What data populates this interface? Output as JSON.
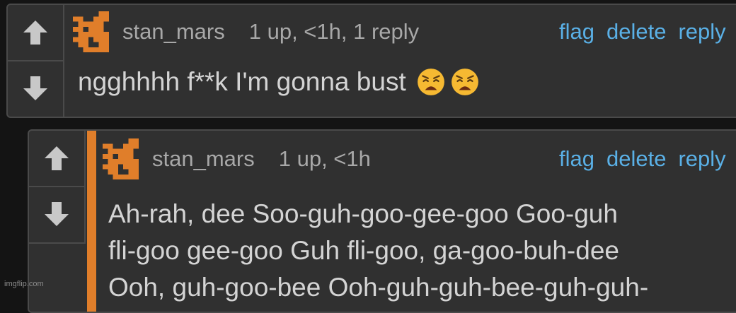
{
  "comments": [
    {
      "username": "stan_mars",
      "meta": "1 up, <1h, 1 reply",
      "actions": {
        "flag": "flag",
        "delete": "delete",
        "reply": "reply"
      },
      "text": "ngghhhh f**k I'm gonna bust",
      "emojis": [
        "weary-face-icon",
        "weary-face-icon"
      ]
    },
    {
      "username": "stan_mars",
      "meta": "1 up, <1h",
      "actions": {
        "flag": "flag",
        "delete": "delete",
        "reply": "reply"
      },
      "lines": [
        "Ah-rah, dee Soo-guh-goo-gee-goo Goo-guh",
        "fli-goo gee-goo Guh fli-goo, ga-goo-buh-dee",
        "Ooh, guh-goo-bee Ooh-guh-guh-bee-guh-guh-"
      ]
    }
  ],
  "watermark": "imgflip.com",
  "colors": {
    "background": "#141414",
    "card": "#303030",
    "link": "#5ab0e6",
    "reply_bar": "#e07e2a"
  }
}
